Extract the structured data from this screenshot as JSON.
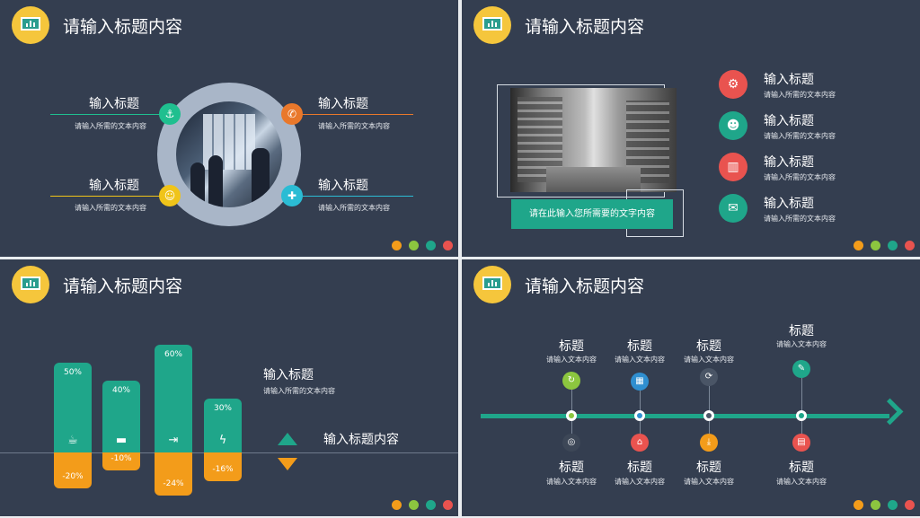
{
  "slides": {
    "s1": {
      "title": "请输入标题内容",
      "items": [
        {
          "heading": "输入标题",
          "text": "请输入所需的文本内容",
          "color": "#1fbf8f",
          "icon": "anchor-icon"
        },
        {
          "heading": "输入标题",
          "text": "请输入所需的文本内容",
          "color": "#e9782b",
          "icon": "phone-icon"
        },
        {
          "heading": "输入标题",
          "text": "请输入所需的文本内容",
          "color": "#f0c419",
          "icon": "user-icon"
        },
        {
          "heading": "输入标题",
          "text": "请输入所需的文本内容",
          "color": "#2bbcd4",
          "icon": "puzzle-icon"
        }
      ]
    },
    "s2": {
      "title": "请输入标题内容",
      "caption": "请在此输入您所需要的文字内容",
      "items": [
        {
          "heading": "输入标题",
          "text": "请输入所需的文本内容",
          "color": "#e9534f",
          "icon": "gears-icon"
        },
        {
          "heading": "输入标题",
          "text": "请输入所需的文本内容",
          "color": "#1fa68a",
          "icon": "head-icon"
        },
        {
          "heading": "输入标题",
          "text": "请输入所需的文本内容",
          "color": "#e9534f",
          "icon": "bar-chart-icon"
        },
        {
          "heading": "输入标题",
          "text": "请输入所需的文本内容",
          "color": "#1fa68a",
          "icon": "message-icon"
        }
      ]
    },
    "s3": {
      "title": "请输入标题内容",
      "heading": "输入标题",
      "text": "请输入所需的文本内容",
      "legend_heading": "输入标题内容",
      "chart_data": {
        "type": "bar",
        "categories": [
          "coffee",
          "bed",
          "exit",
          "flash"
        ],
        "positive": [
          50,
          40,
          60,
          30
        ],
        "negative": [
          -20,
          -10,
          -24,
          -16
        ],
        "positive_labels": [
          "50%",
          "40%",
          "60%",
          "30%"
        ],
        "negative_labels": [
          "-20%",
          "-10%",
          "-24%",
          "-16%"
        ]
      }
    },
    "s4": {
      "title": "请输入标题内容",
      "top": [
        {
          "heading": "标题",
          "text": "请输入文本内容",
          "color": "#8cc63f"
        },
        {
          "heading": "标题",
          "text": "请输入文本内容",
          "color": "#2f8fd0"
        },
        {
          "heading": "标题",
          "text": "请输入文本内容",
          "color": "#4a5566"
        },
        {
          "heading": "标题",
          "text": "请输入文本内容",
          "color": "#1fa68a"
        }
      ],
      "bottom": [
        {
          "heading": "标题",
          "text": "请输入文本内容",
          "color": "#3d4757"
        },
        {
          "heading": "标题",
          "text": "请输入文本内容",
          "color": "#e9534f"
        },
        {
          "heading": "标题",
          "text": "请输入文本内容",
          "color": "#f39c1a"
        },
        {
          "heading": "标题",
          "text": "请输入文本内容",
          "color": "#e9534f"
        }
      ]
    }
  },
  "dot_colors": [
    "#f39c1a",
    "#8cc63f",
    "#1fa68a",
    "#e9534f"
  ]
}
